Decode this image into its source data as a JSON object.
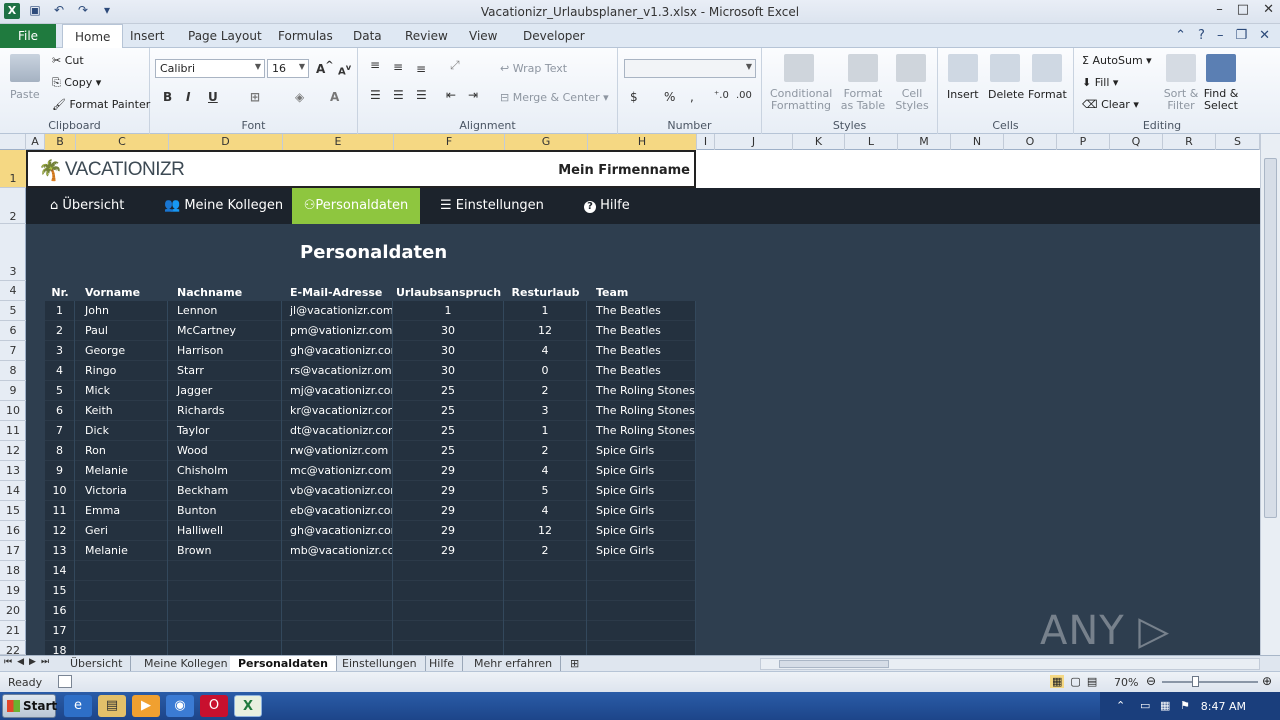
{
  "window": {
    "title": "Vacationizr_Urlaubsplaner_v1.3.xlsx - Microsoft Excel",
    "app_icon": "X"
  },
  "ribbon_tabs": [
    "File",
    "Home",
    "Insert",
    "Page Layout",
    "Formulas",
    "Data",
    "Review",
    "View",
    "Developer"
  ],
  "ribbon": {
    "clipboard": {
      "paste": "Paste",
      "cut": "Cut",
      "copy": "Copy",
      "format_painter": "Format Painter",
      "label": "Clipboard"
    },
    "font": {
      "family": "Calibri",
      "size": "16",
      "bold": "B",
      "italic": "I",
      "underline": "U",
      "label": "Font"
    },
    "alignment": {
      "wrap_text": "Wrap Text",
      "merge_center": "Merge & Center",
      "label": "Alignment"
    },
    "number": {
      "currency": "$",
      "percent": "%",
      "comma": ",",
      "label": "Number"
    },
    "styles": {
      "conditional_formatting": "Conditional Formatting",
      "format_as_table": "Format as Table",
      "cell_styles": "Cell Styles",
      "label": "Styles"
    },
    "cells": {
      "insert": "Insert",
      "delete": "Delete",
      "format": "Format",
      "label": "Cells"
    },
    "editing": {
      "autosum": "AutoSum",
      "fill": "Fill",
      "clear": "Clear",
      "sort_filter": "Sort & Filter",
      "find_select": "Find & Select",
      "label": "Editing"
    }
  },
  "columns": [
    "A",
    "B",
    "C",
    "D",
    "E",
    "F",
    "G",
    "H",
    "I",
    "J",
    "K",
    "L",
    "M",
    "N",
    "O",
    "P",
    "Q",
    "R",
    "S"
  ],
  "rows": [
    "1",
    "2",
    "3",
    "4",
    "5",
    "6",
    "7",
    "8",
    "9",
    "10",
    "11",
    "12",
    "13",
    "14",
    "15",
    "16",
    "17",
    "18",
    "19",
    "20",
    "21",
    "22"
  ],
  "sheet": {
    "logo_text": "VACATIONIZR",
    "company_name": "Mein Firmenname",
    "nav": [
      {
        "icon": "home-icon",
        "glyph": "⌂",
        "label": "Übersicht"
      },
      {
        "icon": "users-icon",
        "glyph": "👥",
        "label": "Meine Kollegen"
      },
      {
        "icon": "people-icon",
        "glyph": "⚇",
        "label": "Personaldaten"
      },
      {
        "icon": "sliders-icon",
        "glyph": "☰",
        "label": "Einstellungen"
      },
      {
        "icon": "help-icon",
        "glyph": "?",
        "label": "Hilfe"
      }
    ],
    "heading": "Personaldaten",
    "headers": [
      "Nr.",
      "Vorname",
      "Nachname",
      "E-Mail-Adresse",
      "Urlaubsanspruch",
      "Resturlaub",
      "Team"
    ],
    "rows": [
      [
        "1",
        "John",
        "Lennon",
        "jl@vacationizr.com",
        "1",
        "1",
        "The Beatles"
      ],
      [
        "2",
        "Paul",
        "McCartney",
        "pm@vationizr.com",
        "30",
        "12",
        "The Beatles"
      ],
      [
        "3",
        "George",
        "Harrison",
        "gh@vacationizr.com",
        "30",
        "4",
        "The Beatles"
      ],
      [
        "4",
        "Ringo",
        "Starr",
        "rs@vacationizr.om",
        "30",
        "0",
        "The Beatles"
      ],
      [
        "5",
        "Mick",
        "Jagger",
        "mj@vacationizr.com",
        "25",
        "2",
        "The Roling Stones"
      ],
      [
        "6",
        "Keith",
        "Richards",
        "kr@vacationizr.com",
        "25",
        "3",
        "The Roling Stones"
      ],
      [
        "7",
        "Dick",
        "Taylor",
        "dt@vacationizr.com",
        "25",
        "1",
        "The Roling Stones"
      ],
      [
        "8",
        "Ron",
        "Wood",
        "rw@vationizr.com",
        "25",
        "2",
        "Spice Girls"
      ],
      [
        "9",
        "Melanie",
        "Chisholm",
        "mc@vationizr.com",
        "29",
        "4",
        "Spice Girls"
      ],
      [
        "10",
        "Victoria",
        "Beckham",
        "vb@vacationizr.com",
        "29",
        "5",
        "Spice Girls"
      ],
      [
        "11",
        "Emma",
        "Bunton",
        "eb@vacationizr.com",
        "29",
        "4",
        "Spice Girls"
      ],
      [
        "12",
        "Geri",
        "Halliwell",
        "gh@vacationizr.com",
        "29",
        "12",
        "Spice Girls"
      ],
      [
        "13",
        "Melanie",
        "Brown",
        "mb@vacationizr.com",
        "29",
        "2",
        "Spice Girls"
      ],
      [
        "14",
        "",
        "",
        "",
        "",
        "",
        ""
      ],
      [
        "15",
        "",
        "",
        "",
        "",
        "",
        ""
      ],
      [
        "16",
        "",
        "",
        "",
        "",
        "",
        ""
      ],
      [
        "17",
        "",
        "",
        "",
        "",
        "",
        ""
      ],
      [
        "18",
        "",
        "",
        "",
        "",
        "",
        ""
      ]
    ]
  },
  "sheet_tabs": [
    "Übersicht",
    "Meine Kollegen",
    "Personaldaten",
    "Einstellungen",
    "Hilfe",
    "Mehr erfahren"
  ],
  "active_sheet": "Personaldaten",
  "status": {
    "ready": "Ready",
    "zoom": "70%"
  },
  "watermark": "ANY ▷ RUN",
  "taskbar": {
    "start": "Start",
    "time": "8:47 AM"
  },
  "colors": {
    "nav_bg": "#1c232c",
    "nav_active": "#8ec63f",
    "content_bg": "#2e3e4f",
    "row_bg": "#24313f",
    "excel_green": "#1f7a3e"
  }
}
